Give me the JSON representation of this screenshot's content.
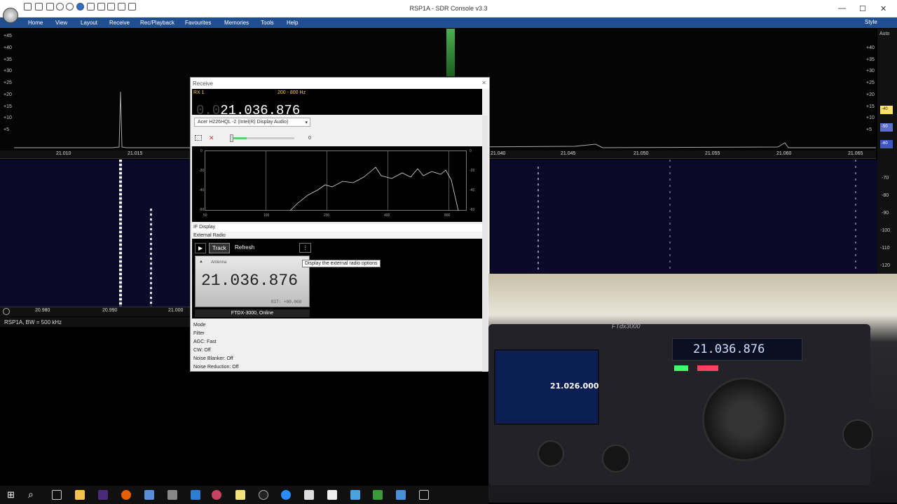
{
  "window": {
    "title": "RSP1A - SDR Console v3.3",
    "controls": {
      "minimize": "—",
      "maximize": "☐",
      "close": "✕"
    }
  },
  "menu": {
    "items": [
      "Home",
      "View",
      "Layout",
      "Receive",
      "Rec/Playback",
      "Favourites",
      "Memories",
      "Tools",
      "Help"
    ],
    "style_label": "Style"
  },
  "spectrum": {
    "y_labels": [
      "+45",
      "+40",
      "+35",
      "+30",
      "+25",
      "+20",
      "+15",
      "+10",
      "+5"
    ],
    "x_ticks": [
      "21.010",
      "21.015",
      "21.040",
      "21.045",
      "21.050",
      "21.055",
      "21.060",
      "21.065"
    ],
    "right_auto": "Auto",
    "right_scale": [
      "+40",
      "+35",
      "+30",
      "+25",
      "+20",
      "+15",
      "+10",
      "+5"
    ],
    "right_badges": [
      "-40",
      "-50",
      "-60"
    ],
    "right_scale2": [
      "-70",
      "-80",
      "-90",
      "-100",
      "-110",
      "-120"
    ]
  },
  "waterfall_axis": {
    "ticks": [
      "20.980",
      "20.990",
      "21.000"
    ]
  },
  "status": {
    "text": "RSP1A, BW = 500 kHz"
  },
  "receive": {
    "title": "Receive",
    "rx_label": "RX 1",
    "bandwidth": "200 - 800 Hz",
    "freq_dim": "0.0",
    "freq": "21.036.876",
    "audio_device": "Acer H226HQL -2 (Intel(R) Display Audio)",
    "volume_value": "0",
    "audio_y": [
      "0",
      "-20",
      "-40",
      "-60"
    ],
    "audio_x": [
      "50",
      "100",
      "200",
      "400",
      "800"
    ],
    "if_display": "IF Display",
    "external_radio": "External Radio",
    "btn_track": "Track",
    "btn_refresh": "Refresh",
    "tooltip": "Display the external radio options",
    "lcd_antenna": "Antenna",
    "lcd_freq": "21.036.876",
    "lcd_rit": "RIT: +00.000",
    "radio_status": "FTDX-3000, Online",
    "options": [
      "Mode",
      "Filter",
      "AGC: Fast",
      "CW: Off",
      "Noise Blanker: Off",
      "Noise Reduction: Off"
    ]
  },
  "camera": {
    "brand": "FTdx3000",
    "display_freq": "21.036.876",
    "sub_freq": "21.026.000"
  }
}
